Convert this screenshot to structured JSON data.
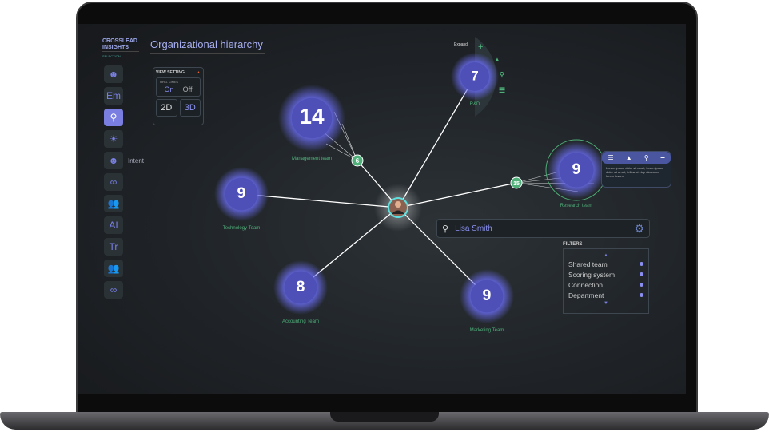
{
  "brand": {
    "name": "CROSSLEAD INSIGHTS",
    "sub": "SELECTION"
  },
  "title": "Organizational hierarchy",
  "sidebar": [
    {
      "icon": "head-gear-icon"
    },
    {
      "label": "Em"
    },
    {
      "icon": "location-pin-icon",
      "active": true
    },
    {
      "icon": "lightbulb-icon"
    },
    {
      "icon": "head-gear-icon",
      "label": "Intent"
    },
    {
      "icon": "binoculars-icon"
    },
    {
      "icon": "people-icon"
    },
    {
      "label": "AI"
    },
    {
      "label": "Tr"
    },
    {
      "icon": "people-icon"
    },
    {
      "icon": "binoculars-icon"
    }
  ],
  "view_setting": {
    "title": "VIEW SETTING",
    "org_lines": "ORG. LINES",
    "on": "On",
    "off": "Off",
    "d2": "2D",
    "d3": "3D"
  },
  "search": {
    "value": "Lisa Smith"
  },
  "filters": {
    "title": "FILTERS",
    "items": [
      "Shared team",
      "Scoring system",
      "Connection",
      "Department"
    ]
  },
  "expand_label": "Expand",
  "tooltip": {
    "text": "Lorem ipsum dolor sit amet, lorem ipsum dolor sit amet, fellow si elap ula coner lorem ipsum."
  },
  "teams": [
    {
      "name": "Management team",
      "count": "14",
      "badge": "6"
    },
    {
      "name": "Technology Team",
      "count": "9"
    },
    {
      "name": "Accounting Team",
      "count": "8"
    },
    {
      "name": "Marketing Team",
      "count": "9"
    },
    {
      "name": "R&D",
      "count": "7"
    },
    {
      "name": "Research team",
      "count": "9",
      "badge": "15"
    }
  ],
  "colors": {
    "accent": "#7a7ee0",
    "green": "#4fb07a",
    "node": "#5a5cc8"
  }
}
